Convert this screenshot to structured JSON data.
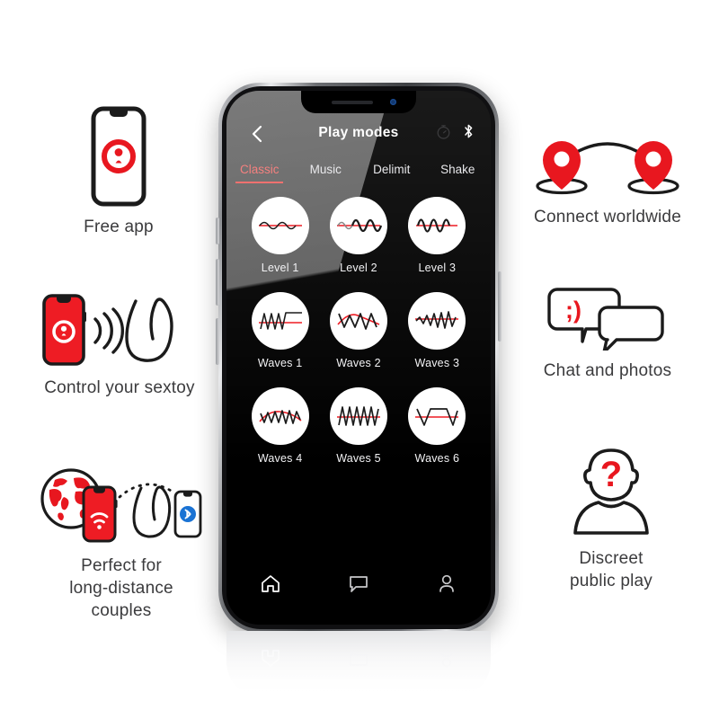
{
  "phone_app": {
    "title": "Play modes",
    "back_icon": "chevron-left-icon",
    "top_icons": [
      "timer-icon",
      "bluetooth-icon"
    ],
    "tabs": [
      {
        "label": "Classic",
        "active": true
      },
      {
        "label": "Music",
        "active": false
      },
      {
        "label": "Delimit",
        "active": false
      },
      {
        "label": "Shake",
        "active": false
      }
    ],
    "modes": [
      {
        "label": "Level 1",
        "wave": "sine-low"
      },
      {
        "label": "Level 2",
        "wave": "sine-mid"
      },
      {
        "label": "Level 3",
        "wave": "sine-high"
      },
      {
        "label": "Waves 1",
        "wave": "saw-rise-plateau"
      },
      {
        "label": "Waves 2",
        "wave": "zigzag-arch"
      },
      {
        "label": "Waves 3",
        "wave": "zigzag-rise"
      },
      {
        "label": "Waves 4",
        "wave": "zigzag-dense"
      },
      {
        "label": "Waves 5",
        "wave": "triangle-dense"
      },
      {
        "label": "Waves 6",
        "wave": "trapezoid"
      }
    ],
    "nav": [
      {
        "icon": "home-icon",
        "active": true
      },
      {
        "icon": "chat-bubble-icon",
        "active": false
      },
      {
        "icon": "profile-icon",
        "active": false
      }
    ],
    "accent_color": "#f0716f",
    "screen_background": "#000000"
  },
  "features": {
    "free_app": {
      "caption": "Free app",
      "icon": "phone-with-logo-icon"
    },
    "control": {
      "caption": "Control your sextoy",
      "icon": "phone-signal-toy-icon"
    },
    "long_distance": {
      "caption": "Perfect for\nlong-distance\ncouples",
      "icon": "globe-phone-toy-bluetooth-icon",
      "lines": [
        "Perfect for",
        "long-distance",
        "couples"
      ]
    },
    "connect": {
      "caption": "Connect worldwide",
      "icon": "two-map-pins-arc-icon"
    },
    "chat": {
      "caption": "Chat and photos",
      "icon": "speech-bubbles-wink-icon",
      "emoticon": ";)"
    },
    "discreet": {
      "caption": "Discreet\npublic play",
      "icon": "anonymous-person-question-icon",
      "lines": [
        "Discreet",
        "public play"
      ]
    }
  },
  "colors": {
    "brand_red": "#e8171f",
    "accent_pink": "#f0716f",
    "bluetooth_blue": "#1a73d4",
    "text_gray": "#3b3b3d",
    "page_background": "#ffffff"
  }
}
